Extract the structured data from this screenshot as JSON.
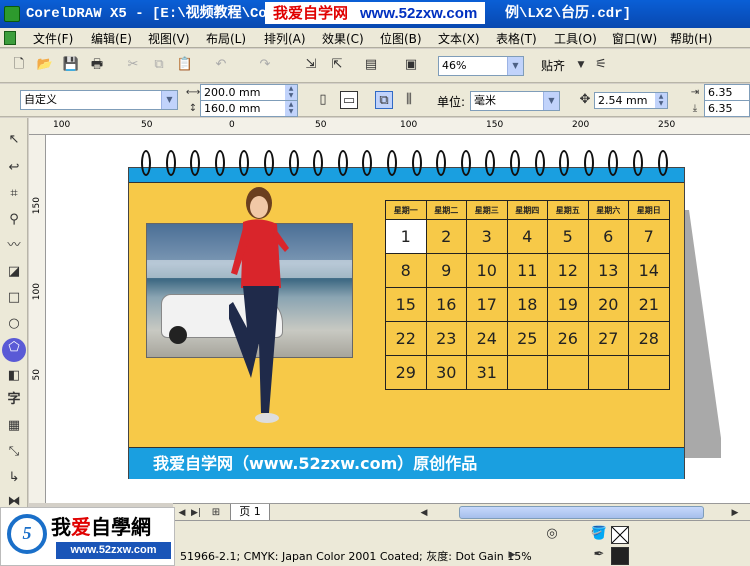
{
  "window": {
    "title_left": "CorelDRAW X5 - [E:\\视频教程\\Core",
    "title_right": "例\\LX2\\台历.cdr]"
  },
  "watermark": {
    "text": "我爱自学网",
    "url": "www.52zxw.com"
  },
  "menu": [
    "文件(F)",
    "编辑(E)",
    "视图(V)",
    "布局(L)",
    "排列(A)",
    "效果(C)",
    "位图(B)",
    "文本(X)",
    "表格(T)",
    "工具(O)",
    "窗口(W)",
    "帮助(H)"
  ],
  "toolbar": {
    "zoom": "46%",
    "snap_label": "贴齐"
  },
  "propertybar": {
    "page_preset": "自定义",
    "width": "200.0 mm",
    "height": "160.0 mm",
    "unit_label": "单位:",
    "unit": "毫米",
    "nudge": "2.54 mm",
    "dup_x": "6.35 mm",
    "dup_y": "6.35 mm"
  },
  "rulers": {
    "h": [
      "100",
      "50",
      "0",
      "50",
      "100",
      "150",
      "200",
      "250"
    ],
    "v": [
      "150",
      "100",
      "50"
    ]
  },
  "calendar": {
    "weekdays": [
      "星期一",
      "星期二",
      "星期三",
      "星期四",
      "星期五",
      "星期六",
      "星期日"
    ],
    "weeks": [
      [
        "1",
        "2",
        "3",
        "4",
        "5",
        "6",
        "7"
      ],
      [
        "8",
        "9",
        "10",
        "11",
        "12",
        "13",
        "14"
      ],
      [
        "15",
        "16",
        "17",
        "18",
        "19",
        "20",
        "21"
      ],
      [
        "22",
        "23",
        "24",
        "25",
        "26",
        "27",
        "28"
      ],
      [
        "29",
        "30",
        "31",
        "",
        "",
        "",
        ""
      ]
    ],
    "footer": "我爱自学网（www.52zxw.com）原创作品",
    "colors": {
      "board": "#f7c948",
      "band": "#1a9fe0"
    }
  },
  "pages": {
    "tab": "页 1"
  },
  "status": {
    "color_profile": "51966-2.1; CMYK: Japan Color 2001 Coated; 灰度: Dot Gain 15%"
  },
  "logo": {
    "brand_a": "我",
    "brand_heart": "爱",
    "brand_b": "自學網",
    "site": "www.52zxw.com",
    "badge": "5"
  }
}
